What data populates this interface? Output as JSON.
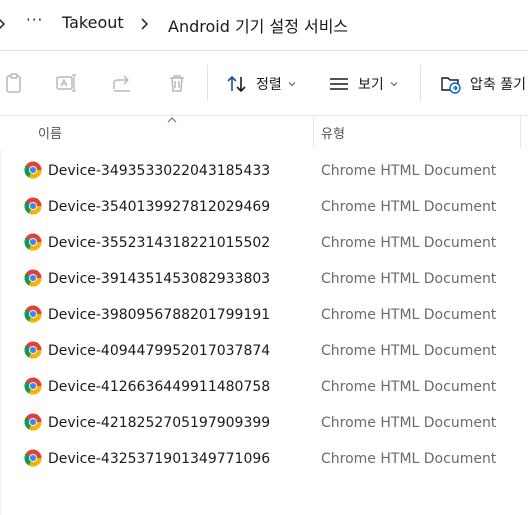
{
  "breadcrumb": {
    "overflow": "···",
    "items": [
      "Takeout",
      "Android 기기 설정 서비스"
    ]
  },
  "toolbar": {
    "sort_label": "정렬",
    "view_label": "보기",
    "extract_label": "압축 풀기"
  },
  "columns": {
    "name": "이름",
    "type": "유형"
  },
  "files": [
    {
      "name": "Device-3493533022043185433",
      "type": "Chrome HTML Document"
    },
    {
      "name": "Device-3540139927812029469",
      "type": "Chrome HTML Document"
    },
    {
      "name": "Device-3552314318221015502",
      "type": "Chrome HTML Document"
    },
    {
      "name": "Device-3914351453082933803",
      "type": "Chrome HTML Document"
    },
    {
      "name": "Device-3980956788201799191",
      "type": "Chrome HTML Document"
    },
    {
      "name": "Device-4094479952017037874",
      "type": "Chrome HTML Document"
    },
    {
      "name": "Device-4126636449911480758",
      "type": "Chrome HTML Document"
    },
    {
      "name": "Device-4218252705197909399",
      "type": "Chrome HTML Document"
    },
    {
      "name": "Device-4325371901349771096",
      "type": "Chrome HTML Document"
    }
  ],
  "colors": {
    "accent": "#0067c0",
    "chrome_red": "#db4437",
    "chrome_yellow": "#f4b400",
    "chrome_green": "#0f9d58",
    "chrome_blue": "#4285f4"
  }
}
